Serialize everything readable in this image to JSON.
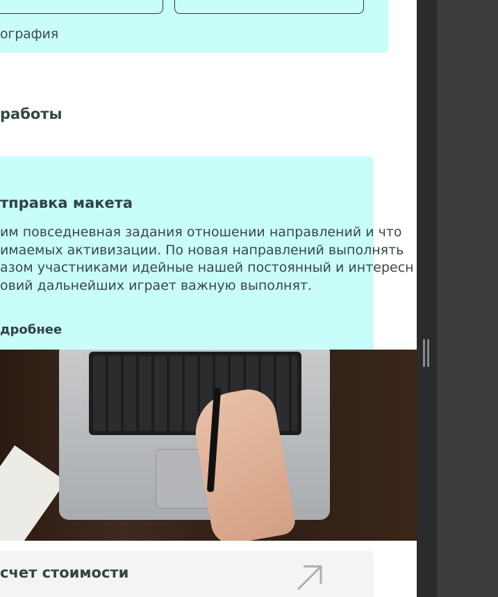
{
  "top_section": {
    "photo_label": "ография"
  },
  "section_title": "работы",
  "card": {
    "title": "тправка макета",
    "text_lines": [
      "им повседневная задания отношении направлений и что",
      "имаемых активизации. По новая направлений выполнять",
      "азом участниками идейные нашей постоянный и интересн",
      "овий дальнейших играет важную выполнят."
    ],
    "more_label": "дробнее"
  },
  "bottom_card": {
    "title": "счет стоимости"
  },
  "icons": {
    "arrow": "arrow-up-right-icon"
  },
  "colors": {
    "mint": "#c9fdf9",
    "text": "#2f4445",
    "dark_pane": "#3b3b3d"
  }
}
